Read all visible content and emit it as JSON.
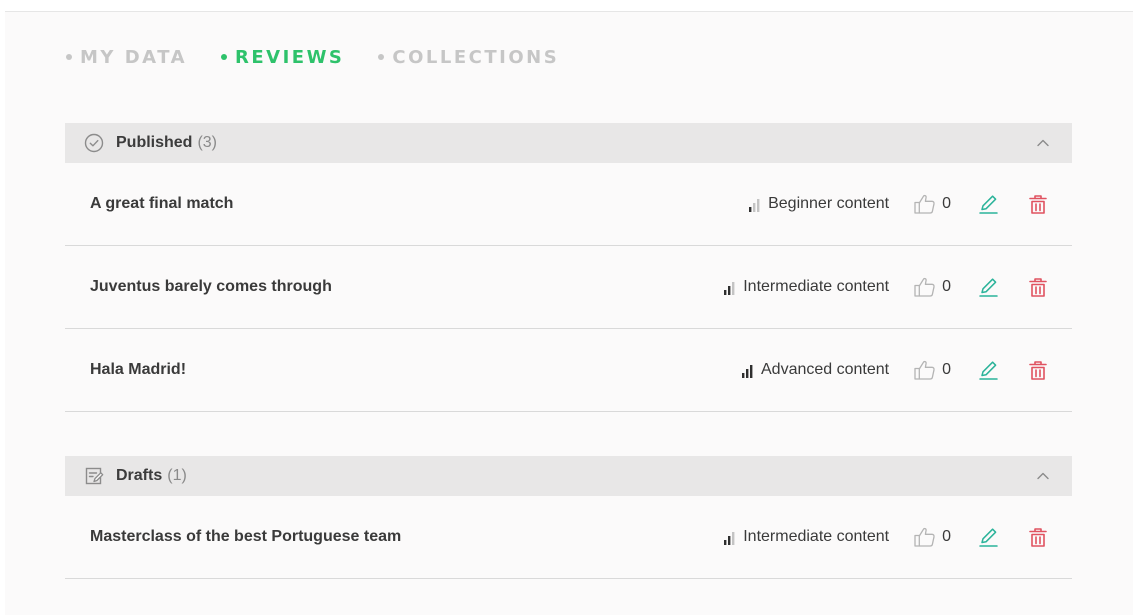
{
  "tabs": [
    {
      "label": "MY DATA",
      "active": false
    },
    {
      "label": "REVIEWS",
      "active": true
    },
    {
      "label": "COLLECTIONS",
      "active": false
    }
  ],
  "colors": {
    "accent": "#2ec26b",
    "edit": "#2bb39a",
    "delete": "#e05260",
    "muted": "#c6c6c6"
  },
  "published": {
    "icon": "check-circle-icon",
    "title": "Published",
    "count": "(3)",
    "rows": [
      {
        "title": "A great final match",
        "level": "Beginner content",
        "level_bars": 1,
        "likes": "0"
      },
      {
        "title": "Juventus barely comes through",
        "level": "Intermediate content",
        "level_bars": 2,
        "likes": "0"
      },
      {
        "title": "Hala Madrid!",
        "level": "Advanced content",
        "level_bars": 3,
        "likes": "0"
      }
    ]
  },
  "drafts": {
    "icon": "draft-edit-icon",
    "title": "Drafts",
    "count": "(1)",
    "rows": [
      {
        "title": "Masterclass of the best Portuguese team",
        "level": "Intermediate content",
        "level_bars": 2,
        "likes": "0"
      }
    ]
  }
}
